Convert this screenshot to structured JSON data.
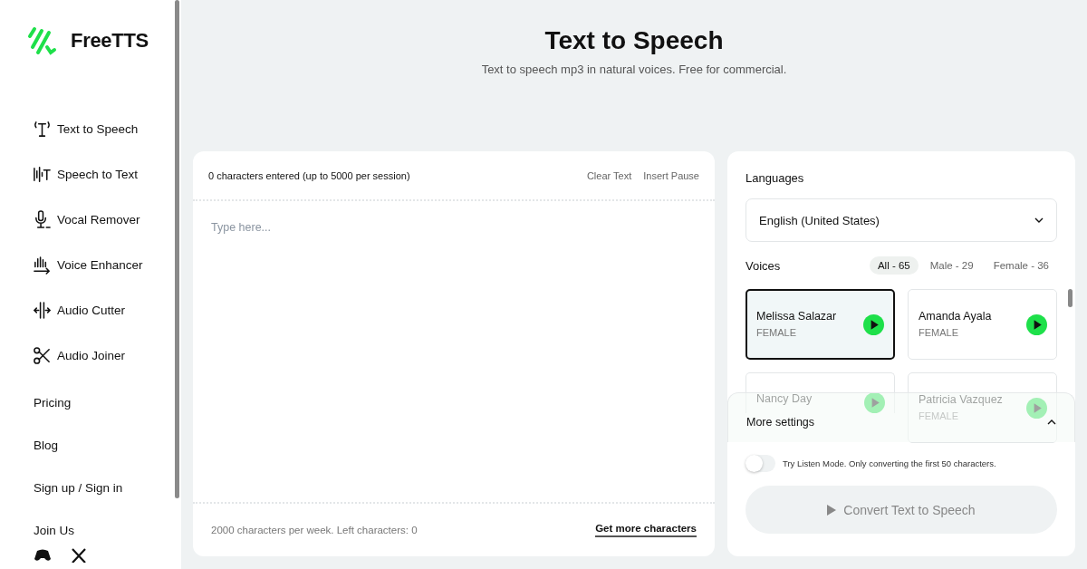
{
  "logo": {
    "text": "FreeTTS"
  },
  "sidebar": {
    "tools": [
      {
        "label": "Text to Speech",
        "kind": "tts"
      },
      {
        "label": "Speech to Text",
        "kind": "stt"
      },
      {
        "label": "Vocal Remover",
        "kind": "mic"
      },
      {
        "label": "Voice Enhancer",
        "kind": "enhance"
      },
      {
        "label": "Audio Cutter",
        "kind": "cut"
      },
      {
        "label": "Audio Joiner",
        "kind": "join"
      }
    ],
    "links": [
      "Pricing",
      "Blog",
      "Sign up / Sign in",
      "Join Us"
    ]
  },
  "header": {
    "title": "Text to Speech",
    "subtitle": "Text to speech mp3 in natural voices. Free for commercial."
  },
  "editor": {
    "counter": "0 characters entered (up to 5000 per session)",
    "actions": [
      "Clear Text",
      "Insert Pause"
    ],
    "placeholder": "Type here...",
    "quota": "2000 characters per week. Left characters: 0",
    "more_link": "Get more characters"
  },
  "settings": {
    "languages_label": "Languages",
    "language": "English (United States)",
    "voices_label": "Voices",
    "filters": [
      {
        "label": "All - 65",
        "selected": true
      },
      {
        "label": "Male - 29",
        "selected": false
      },
      {
        "label": "Female - 36",
        "selected": false
      }
    ],
    "voices": [
      {
        "name": "Melissa Salazar",
        "gender": "FEMALE",
        "selected": true
      },
      {
        "name": "Amanda Ayala",
        "gender": "FEMALE",
        "selected": false
      },
      {
        "name": "Nancy Day",
        "selected": false
      },
      {
        "name": "Patricia Vazquez",
        "gender": "FEMALE",
        "selected": false
      }
    ],
    "more_settings": "More settings",
    "listen_mode": {
      "on": false,
      "label": "Try Listen Mode. Only converting the first 50 characters."
    },
    "convert_button": "Convert Text to Speech"
  }
}
